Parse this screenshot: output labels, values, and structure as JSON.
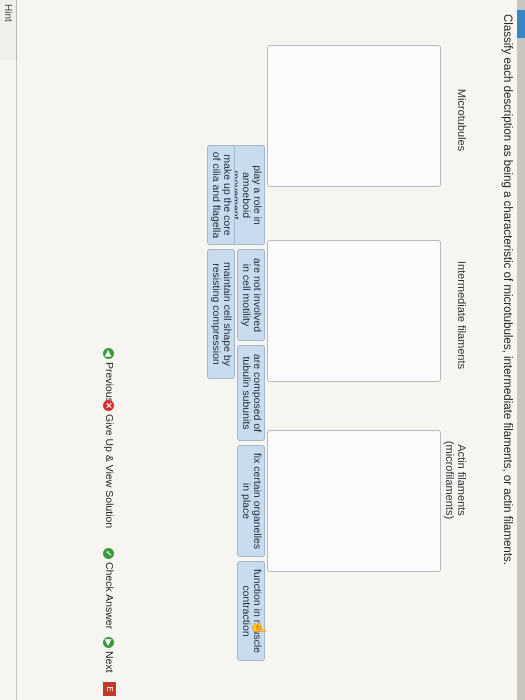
{
  "question": "Classify each description as being a characteristic of microtubules, intermediate filaments, or actin filaments.",
  "columns": [
    {
      "label": "Microtubules"
    },
    {
      "label": "Intermediate filaments"
    },
    {
      "label": "Actin filaments (microfilaments)"
    }
  ],
  "tiles": [
    {
      "text": "play a role in amoeboid movement"
    },
    {
      "text": "are not involved in cell motility"
    },
    {
      "text": "are composed of tubulin subunits"
    },
    {
      "text": "fix certain organelles in place"
    },
    {
      "text": "function in muscle contraction"
    },
    {
      "text": "make up the core of cilia and flagella"
    },
    {
      "text": "maintain cell shape by resisting compression"
    }
  ],
  "nav": {
    "previous": "Previous",
    "give_up": "Give Up & View Solution",
    "check": "Check Answer",
    "next": "Next",
    "exit": "E"
  },
  "hint": "Hint",
  "colors": {
    "tile": "#c9dbec",
    "accent": "#3a86c4",
    "green": "#3c9a3c",
    "red": "#d22f2f"
  },
  "icons": [
    "previous-arrow-icon",
    "give-up-x-icon",
    "check-icon",
    "next-arrow-icon",
    "exit-flag-icon",
    "hand-cursor-icon"
  ]
}
